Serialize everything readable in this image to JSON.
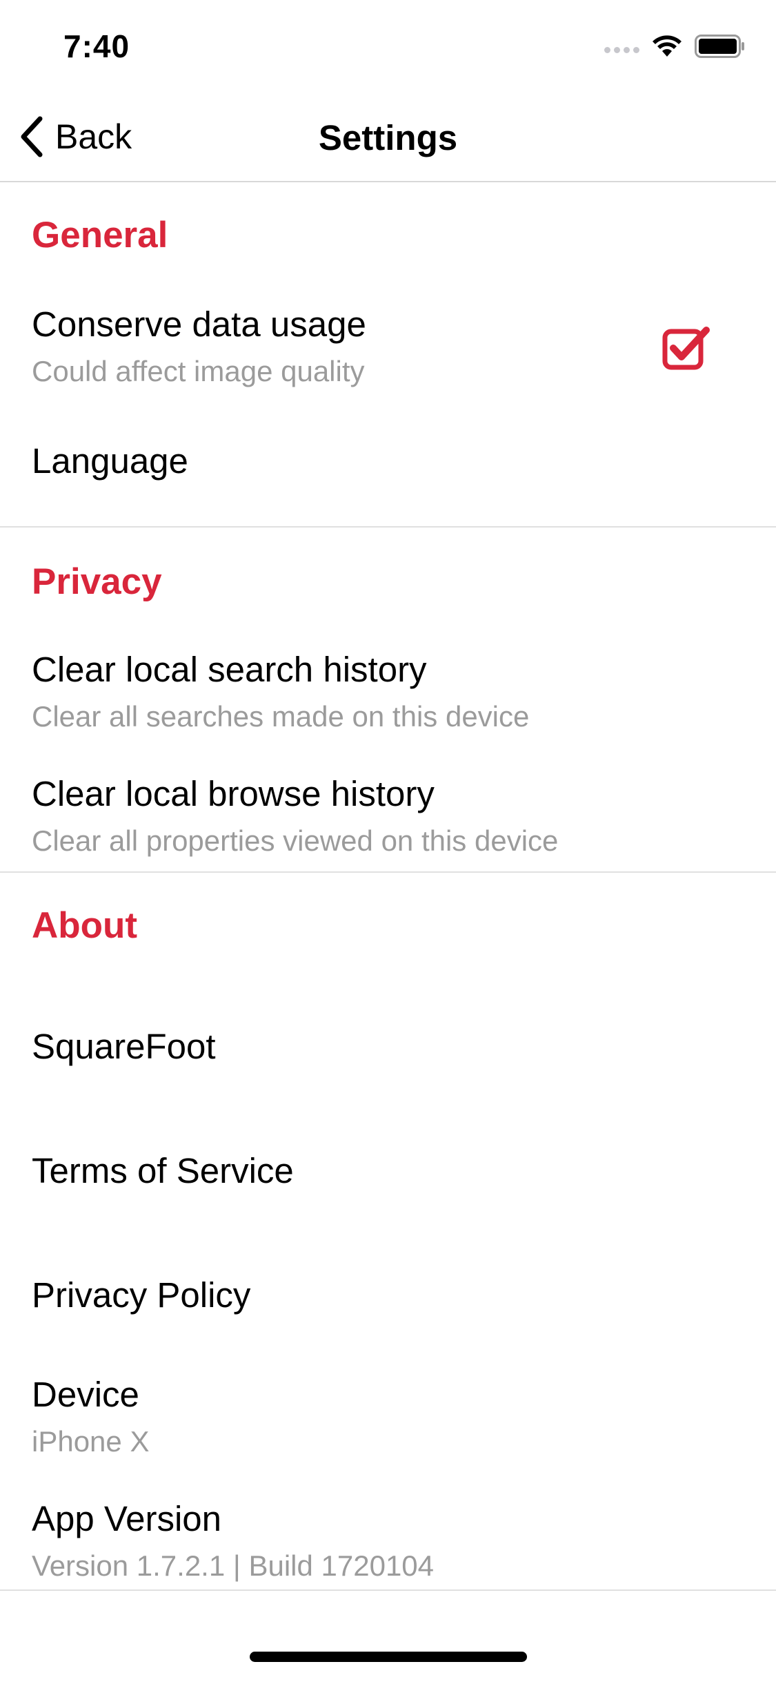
{
  "status_bar": {
    "time": "7:40"
  },
  "nav": {
    "back_label": "Back",
    "title": "Settings"
  },
  "sections": {
    "general": {
      "header": "General",
      "conserve": {
        "title": "Conserve data usage",
        "subtitle": "Could affect image quality",
        "checked": true
      },
      "language": {
        "title": "Language"
      }
    },
    "privacy": {
      "header": "Privacy",
      "clear_search": {
        "title": "Clear local search history",
        "subtitle": "Clear all searches made on this device"
      },
      "clear_browse": {
        "title": "Clear local browse history",
        "subtitle": "Clear all properties viewed on this device"
      }
    },
    "about": {
      "header": "About",
      "squarefoot": {
        "title": "SquareFoot"
      },
      "terms": {
        "title": "Terms of Service"
      },
      "privacy_policy": {
        "title": "Privacy Policy"
      },
      "device": {
        "title": "Device",
        "subtitle": "iPhone X"
      },
      "app_version": {
        "title": "App Version",
        "subtitle": "Version 1.7.2.1 | Build 1720104"
      }
    }
  },
  "colors": {
    "accent": "#d9263b",
    "secondary_text": "#9b9b9b",
    "divider": "#e0e0e0"
  },
  "icons": {
    "back": "chevron-left-icon",
    "checkbox": "checkbox-checked-icon",
    "wifi": "wifi-icon",
    "battery": "battery-icon",
    "signal": "signal-icon"
  }
}
